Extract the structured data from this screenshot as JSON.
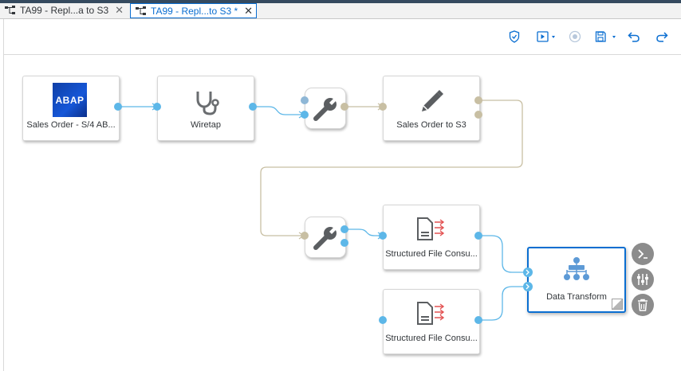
{
  "tabs": [
    {
      "label": "TA99 - Repl...a to S3",
      "active": false
    },
    {
      "label": "TA99 - Repl...to S3 *",
      "active": true
    }
  ],
  "toolbar": {
    "icons": [
      "validate-icon",
      "run-icon",
      "stop-icon",
      "save-icon",
      "undo-icon",
      "redo-icon"
    ]
  },
  "nodes": {
    "source": {
      "label": "Sales Order - S/4 AB...",
      "logo": "ABAP"
    },
    "wiretap": {
      "label": "Wiretap"
    },
    "target": {
      "label": "Sales Order to S3"
    },
    "consumer1": {
      "label": "Structured File Consu..."
    },
    "consumer2": {
      "label": "Structured File Consu..."
    },
    "transform": {
      "label": "Data Transform"
    }
  },
  "colors": {
    "accent": "#0a6ed1",
    "port_blue": "#5db7e8",
    "port_tan": "#c8bfa3",
    "icon_gray": "#6a6d70"
  }
}
